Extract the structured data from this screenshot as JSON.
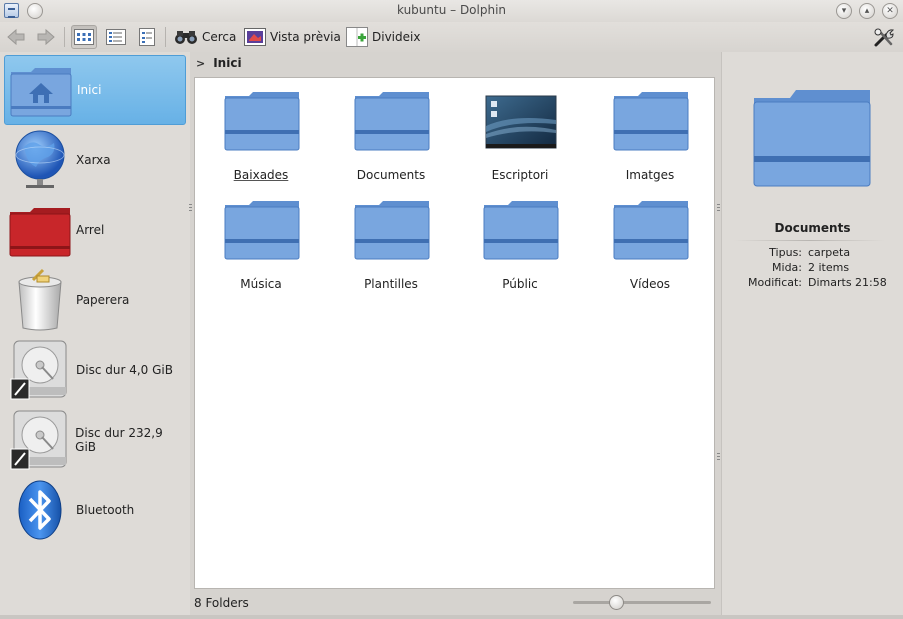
{
  "window": {
    "title": "kubuntu – Dolphin"
  },
  "toolbar": {
    "search_label": "Cerca",
    "preview_label": "Vista prèvia",
    "split_label": "Divideix",
    "icons": [
      "back-icon",
      "forward-icon",
      "icons-view-icon",
      "compact-view-icon",
      "details-view-icon",
      "binoculars-icon",
      "preview-icon",
      "split-icon",
      "tools-icon"
    ]
  },
  "places": [
    {
      "label": "Inici",
      "icon": "home-folder-icon",
      "selected": true
    },
    {
      "label": "Xarxa",
      "icon": "network-globe-icon"
    },
    {
      "label": "Arrel",
      "icon": "root-folder-icon"
    },
    {
      "label": "Paperera",
      "icon": "trash-icon"
    },
    {
      "label": "Disc dur 4,0 GiB",
      "icon": "hard-disk-icon"
    },
    {
      "label": "Disc dur 232,9 GiB",
      "icon": "hard-disk-icon"
    },
    {
      "label": "Bluetooth",
      "icon": "bluetooth-icon"
    }
  ],
  "breadcrumb": {
    "current": "Inici"
  },
  "files": [
    {
      "name": "Baixades",
      "type": "folder"
    },
    {
      "name": "Documents",
      "type": "folder"
    },
    {
      "name": "Escriptori",
      "type": "desktop"
    },
    {
      "name": "Imatges",
      "type": "folder"
    },
    {
      "name": "Música",
      "type": "folder"
    },
    {
      "name": "Plantilles",
      "type": "folder"
    },
    {
      "name": "Públic",
      "type": "folder"
    },
    {
      "name": "Vídeos",
      "type": "folder"
    }
  ],
  "status": {
    "text": "8 Folders",
    "zoom_value": 0.32
  },
  "info_panel": {
    "name": "Documents",
    "rows": [
      {
        "key": "Tipus:",
        "value": "carpeta"
      },
      {
        "key": "Mida:",
        "value": "2 items"
      },
      {
        "key": "Modificat:",
        "value": "Dimarts 21:58"
      }
    ]
  },
  "colors": {
    "folder": "#6f9bd6",
    "folder_stripe": "#3f6fb2",
    "selection": "#6cb4e8",
    "root_folder": "#c8262a"
  }
}
